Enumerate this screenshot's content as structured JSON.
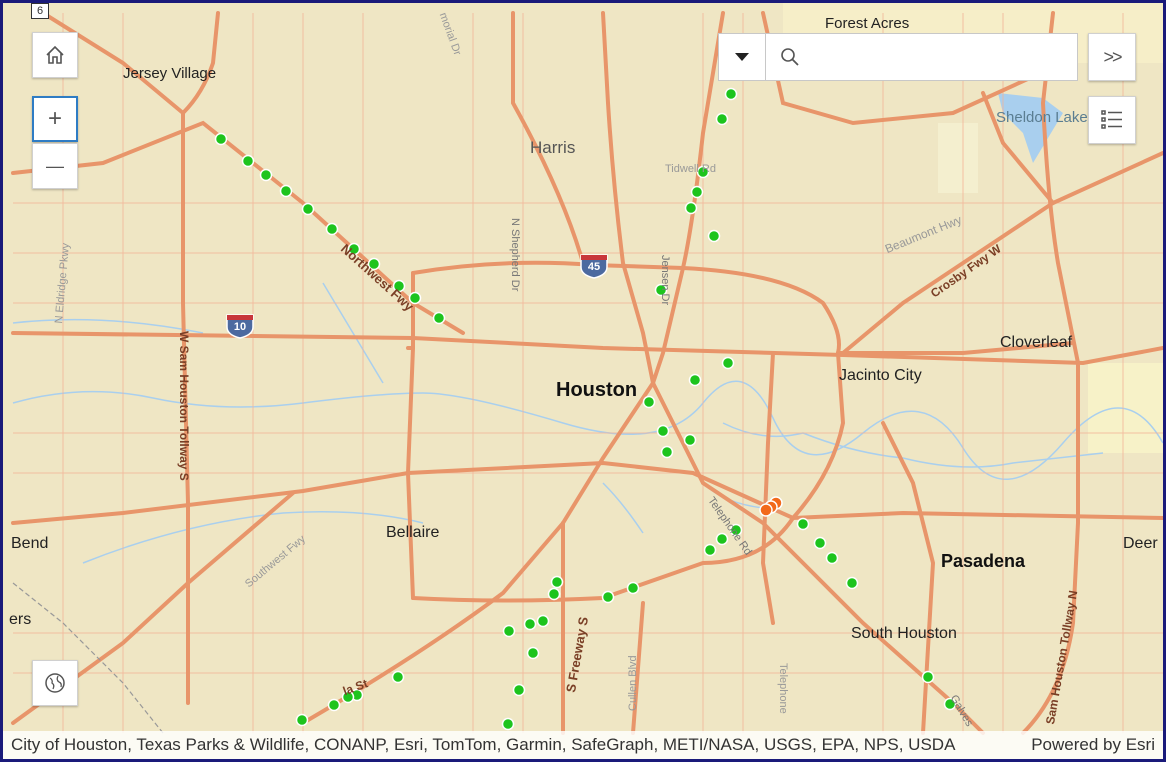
{
  "map": {
    "labels": {
      "houston": "Houston",
      "jersey_village": "Jersey Village",
      "harris": "Harris",
      "forest_acres": "Forest Acres",
      "sheldon_lake": "Sheldon Lake",
      "cloverleaf": "Cloverleaf",
      "jacinto_city": "Jacinto City",
      "pasadena": "Pasadena",
      "south_houston": "South Houston",
      "bellaire": "Bellaire",
      "bend": "Bend",
      "deer": "Deer",
      "ers": "ers",
      "route_6": "6"
    },
    "roads": {
      "northwest_fwy": "Northwest Fwy",
      "w_sam_houston": "W Sam Houston Tollway S",
      "sam_houston_n": "Sam Houston Tollway N",
      "crosby_fwy": "Crosby Fwy W",
      "beaumont_hwy": "Beaumont Hwy",
      "n_shepherd": "N Shepherd Dr",
      "jensen": "Jensen Dr",
      "tidwell": "Tidwell Rd",
      "n_eldridge": "N Eldridge Pkwy",
      "southwest_fwy": "Southwest Fwy",
      "s_freeway": "S Freeway S",
      "cullen": "Cullen Blvd",
      "telephone_rd": "Telephone Rd",
      "telephone_s": "Telephone",
      "memorial": "morial Dr",
      "galveston": "Galves",
      "airport_st": "la St"
    },
    "shields": {
      "i10": "10",
      "i45": "45"
    },
    "colors": {
      "land": "#efe6c4",
      "road": "#e8956a",
      "water": "#9cc8ea",
      "point_green": "#1dc41d",
      "point_orange": "#f26a1b"
    }
  },
  "controls": {
    "home_icon": "home-icon",
    "zoom_in": "+",
    "zoom_out": "—",
    "basemap_icon": "globe-icon",
    "expand_label": ">>",
    "layer_list_icon": "layer-list-icon"
  },
  "search": {
    "placeholder": "",
    "value": ""
  },
  "attribution": {
    "text": "City of Houston, Texas Parks & Wildlife, CONANP, Esri, TomTom, Garmin, SafeGraph, METI/NASA, USGS, EPA, NPS, USDA",
    "powered_by": "Powered by Esri"
  }
}
